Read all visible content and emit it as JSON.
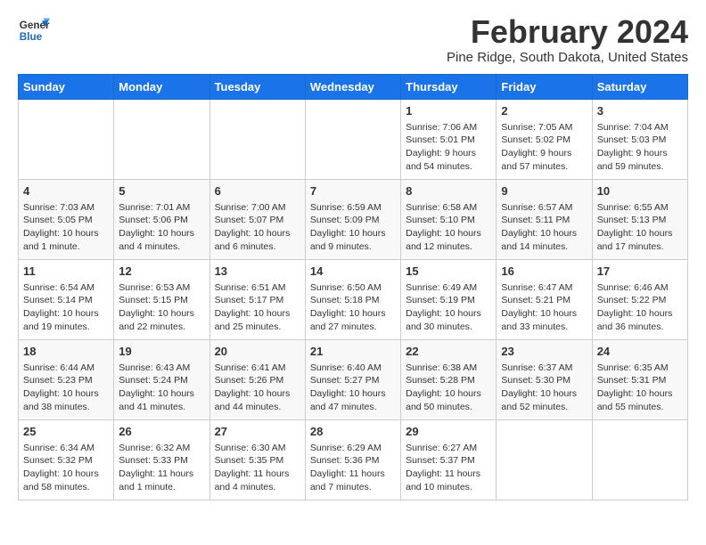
{
  "logo": {
    "line1": "General",
    "line2": "Blue"
  },
  "title": "February 2024",
  "subtitle": "Pine Ridge, South Dakota, United States",
  "days_of_week": [
    "Sunday",
    "Monday",
    "Tuesday",
    "Wednesday",
    "Thursday",
    "Friday",
    "Saturday"
  ],
  "weeks": [
    [
      {
        "day": "",
        "info": ""
      },
      {
        "day": "",
        "info": ""
      },
      {
        "day": "",
        "info": ""
      },
      {
        "day": "",
        "info": ""
      },
      {
        "day": "1",
        "info": "Sunrise: 7:06 AM\nSunset: 5:01 PM\nDaylight: 9 hours and 54 minutes."
      },
      {
        "day": "2",
        "info": "Sunrise: 7:05 AM\nSunset: 5:02 PM\nDaylight: 9 hours and 57 minutes."
      },
      {
        "day": "3",
        "info": "Sunrise: 7:04 AM\nSunset: 5:03 PM\nDaylight: 9 hours and 59 minutes."
      }
    ],
    [
      {
        "day": "4",
        "info": "Sunrise: 7:03 AM\nSunset: 5:05 PM\nDaylight: 10 hours and 1 minute."
      },
      {
        "day": "5",
        "info": "Sunrise: 7:01 AM\nSunset: 5:06 PM\nDaylight: 10 hours and 4 minutes."
      },
      {
        "day": "6",
        "info": "Sunrise: 7:00 AM\nSunset: 5:07 PM\nDaylight: 10 hours and 6 minutes."
      },
      {
        "day": "7",
        "info": "Sunrise: 6:59 AM\nSunset: 5:09 PM\nDaylight: 10 hours and 9 minutes."
      },
      {
        "day": "8",
        "info": "Sunrise: 6:58 AM\nSunset: 5:10 PM\nDaylight: 10 hours and 12 minutes."
      },
      {
        "day": "9",
        "info": "Sunrise: 6:57 AM\nSunset: 5:11 PM\nDaylight: 10 hours and 14 minutes."
      },
      {
        "day": "10",
        "info": "Sunrise: 6:55 AM\nSunset: 5:13 PM\nDaylight: 10 hours and 17 minutes."
      }
    ],
    [
      {
        "day": "11",
        "info": "Sunrise: 6:54 AM\nSunset: 5:14 PM\nDaylight: 10 hours and 19 minutes."
      },
      {
        "day": "12",
        "info": "Sunrise: 6:53 AM\nSunset: 5:15 PM\nDaylight: 10 hours and 22 minutes."
      },
      {
        "day": "13",
        "info": "Sunrise: 6:51 AM\nSunset: 5:17 PM\nDaylight: 10 hours and 25 minutes."
      },
      {
        "day": "14",
        "info": "Sunrise: 6:50 AM\nSunset: 5:18 PM\nDaylight: 10 hours and 27 minutes."
      },
      {
        "day": "15",
        "info": "Sunrise: 6:49 AM\nSunset: 5:19 PM\nDaylight: 10 hours and 30 minutes."
      },
      {
        "day": "16",
        "info": "Sunrise: 6:47 AM\nSunset: 5:21 PM\nDaylight: 10 hours and 33 minutes."
      },
      {
        "day": "17",
        "info": "Sunrise: 6:46 AM\nSunset: 5:22 PM\nDaylight: 10 hours and 36 minutes."
      }
    ],
    [
      {
        "day": "18",
        "info": "Sunrise: 6:44 AM\nSunset: 5:23 PM\nDaylight: 10 hours and 38 minutes."
      },
      {
        "day": "19",
        "info": "Sunrise: 6:43 AM\nSunset: 5:24 PM\nDaylight: 10 hours and 41 minutes."
      },
      {
        "day": "20",
        "info": "Sunrise: 6:41 AM\nSunset: 5:26 PM\nDaylight: 10 hours and 44 minutes."
      },
      {
        "day": "21",
        "info": "Sunrise: 6:40 AM\nSunset: 5:27 PM\nDaylight: 10 hours and 47 minutes."
      },
      {
        "day": "22",
        "info": "Sunrise: 6:38 AM\nSunset: 5:28 PM\nDaylight: 10 hours and 50 minutes."
      },
      {
        "day": "23",
        "info": "Sunrise: 6:37 AM\nSunset: 5:30 PM\nDaylight: 10 hours and 52 minutes."
      },
      {
        "day": "24",
        "info": "Sunrise: 6:35 AM\nSunset: 5:31 PM\nDaylight: 10 hours and 55 minutes."
      }
    ],
    [
      {
        "day": "25",
        "info": "Sunrise: 6:34 AM\nSunset: 5:32 PM\nDaylight: 10 hours and 58 minutes."
      },
      {
        "day": "26",
        "info": "Sunrise: 6:32 AM\nSunset: 5:33 PM\nDaylight: 11 hours and 1 minute."
      },
      {
        "day": "27",
        "info": "Sunrise: 6:30 AM\nSunset: 5:35 PM\nDaylight: 11 hours and 4 minutes."
      },
      {
        "day": "28",
        "info": "Sunrise: 6:29 AM\nSunset: 5:36 PM\nDaylight: 11 hours and 7 minutes."
      },
      {
        "day": "29",
        "info": "Sunrise: 6:27 AM\nSunset: 5:37 PM\nDaylight: 11 hours and 10 minutes."
      },
      {
        "day": "",
        "info": ""
      },
      {
        "day": "",
        "info": ""
      }
    ]
  ]
}
